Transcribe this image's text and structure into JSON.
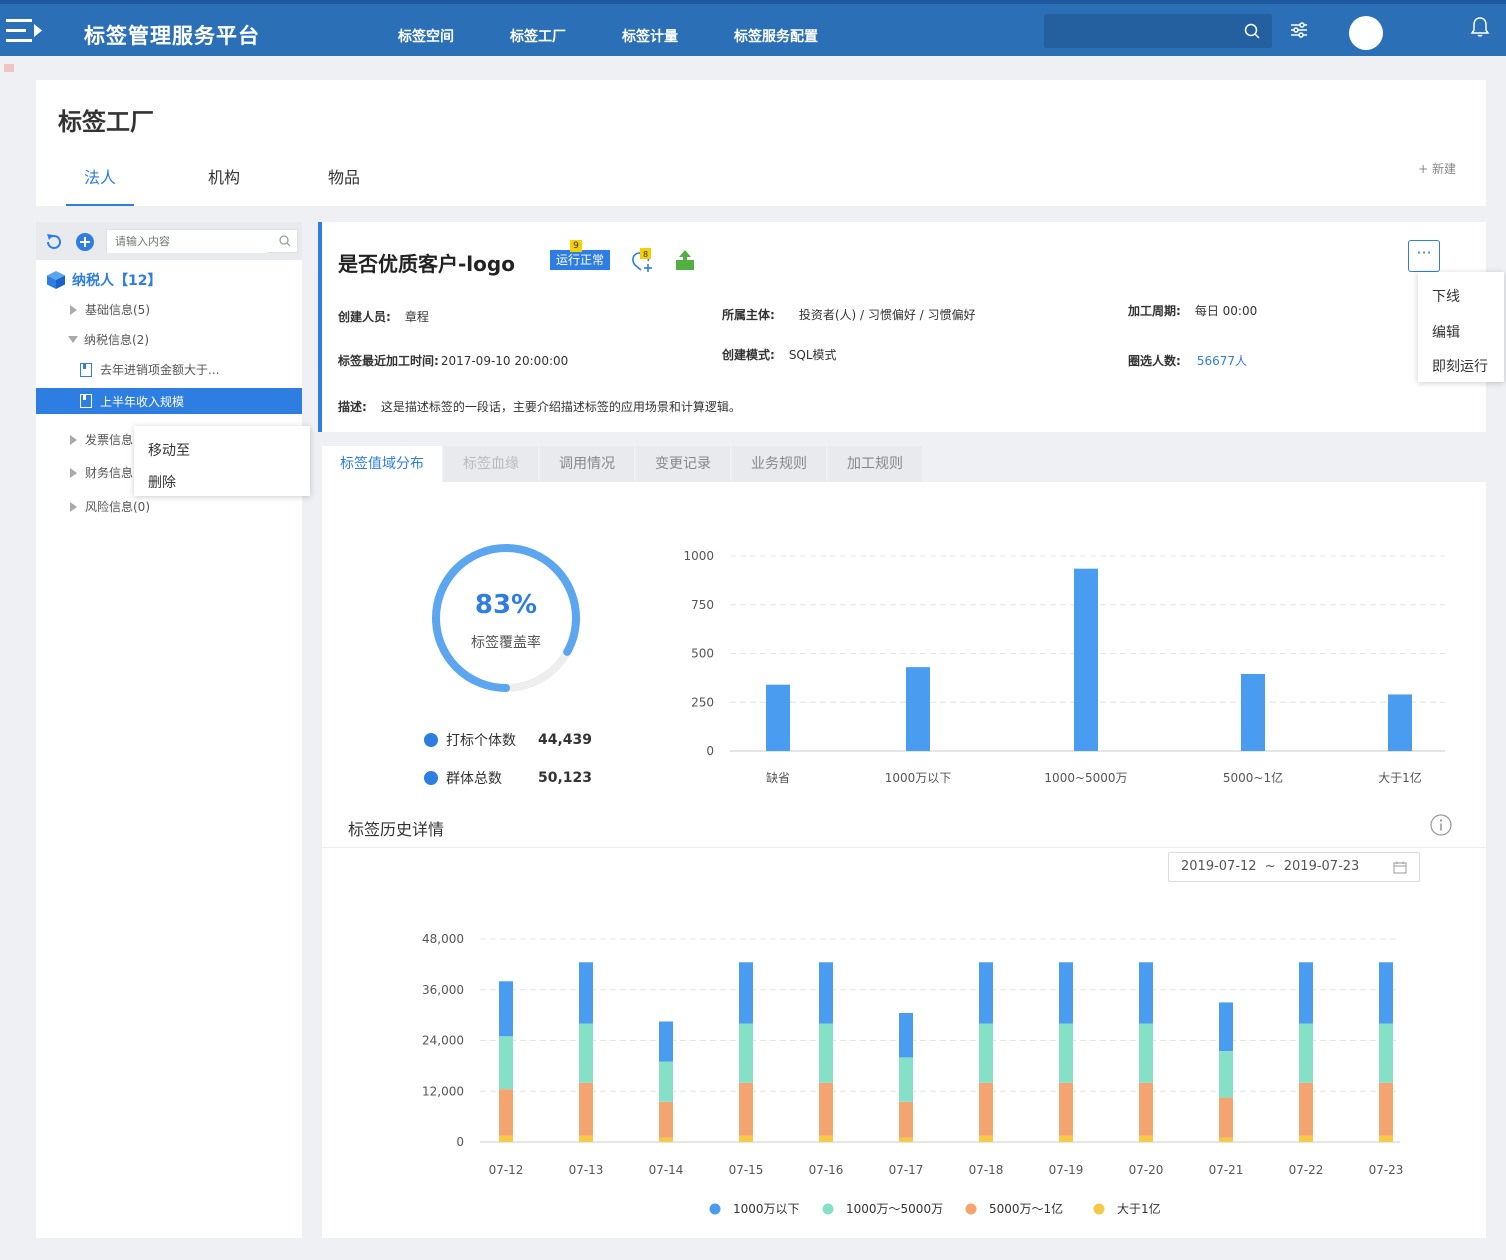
{
  "topbar": {
    "brand": "标签管理服务平台",
    "nav": [
      "标签空间",
      "标签工厂",
      "标签计量",
      "标签服务配置"
    ]
  },
  "header": {
    "title": "标签工厂",
    "tabs": [
      "法人",
      "机构",
      "物品"
    ],
    "new_label": "+ 新建"
  },
  "sidebar": {
    "search_placeholder": "请输入内容",
    "root": "纳税人【12】",
    "items": [
      {
        "label": "基础信息(5)"
      },
      {
        "label": "纳税信息(2)"
      },
      {
        "label": "去年进销项金额大于..."
      },
      {
        "label": "上半年收入规模"
      },
      {
        "label": "发票信息"
      },
      {
        "label": "财务信息"
      },
      {
        "label": "风险信息(0)"
      }
    ],
    "context_menu": [
      "移动至",
      "删除"
    ]
  },
  "detail": {
    "title": "是否优质客户-logo",
    "status": "运行正常",
    "status_count": "9",
    "follow_count": "8",
    "creator_label": "创建人员:",
    "creator": "章程",
    "subject_label": "所属主体:",
    "subject": "投资者(人) / 习惯偏好 / 习惯偏好",
    "cycle_label": "加工周期:",
    "cycle": "每日 00:00",
    "last_time_label": "标签最近加工时间:",
    "last_time": "2017-09-10 20:00:00",
    "mode_label": "创建模式:",
    "mode": "SQL模式",
    "count_label": "圈选人数:",
    "count": "56677人",
    "desc_label": "描述:",
    "desc": "这是描述标签的一段话，主要介绍描述标签的应用场景和计算逻辑。",
    "more_label": "···",
    "actions": [
      "下线",
      "编辑",
      "即刻运行"
    ]
  },
  "content_tabs": [
    "标签值域分布",
    "标签血缘",
    "调用情况",
    "变更记录",
    "业务规则",
    "加工规则"
  ],
  "coverage": {
    "percent": "83%",
    "fraction": 0.83,
    "label": "标签覆盖率",
    "stats": [
      {
        "name": "打标个体数",
        "value": "44,439"
      },
      {
        "name": "群体总数",
        "value": "50,123"
      }
    ]
  },
  "history": {
    "title": "标签历史详情",
    "date_start": "2019-07-12",
    "date_sep": "~",
    "date_end": "2019-07-23"
  },
  "colors": {
    "primary": "#2e7de1",
    "bar_blue": "#4a9cf0",
    "teal": "#86e0c8",
    "orange": "#f4a46e",
    "yellow": "#f7c948"
  },
  "chart_data": [
    {
      "type": "bar",
      "categories": [
        "缺省",
        "1000万以下",
        "1000~5000万",
        "5000~1亿",
        "大于1亿"
      ],
      "values": [
        340,
        430,
        935,
        395,
        290
      ],
      "ylim": [
        0,
        1000
      ],
      "yticks": [
        "0",
        "250",
        "500",
        "750",
        "1000"
      ],
      "grid": true
    },
    {
      "type": "bar",
      "stacked": true,
      "categories": [
        "07-12",
        "07-13",
        "07-14",
        "07-15",
        "07-16",
        "07-17",
        "07-18",
        "07-19",
        "07-20",
        "07-21",
        "07-22",
        "07-23"
      ],
      "series": [
        {
          "name": "大于1亿",
          "values": [
            1500,
            1500,
            1000,
            1500,
            1500,
            1000,
            1500,
            1500,
            1500,
            1000,
            1500,
            1500
          ]
        },
        {
          "name": "5000万~1亿",
          "values": [
            11000,
            12500,
            8500,
            12500,
            12500,
            8500,
            12500,
            12500,
            12500,
            9500,
            12500,
            12500
          ]
        },
        {
          "name": "1000万~5000万",
          "values": [
            12500,
            14000,
            9500,
            14000,
            14000,
            10500,
            14000,
            14000,
            14000,
            11000,
            14000,
            14000
          ]
        },
        {
          "name": "1000万以下",
          "values": [
            13000,
            14500,
            9500,
            14500,
            14500,
            10500,
            14500,
            14500,
            14500,
            11500,
            14500,
            14500
          ]
        }
      ],
      "legend": [
        "1000万以下",
        "1000万～5000万",
        "5000万～1亿",
        "大于1亿"
      ],
      "ylim": [
        0,
        48000
      ],
      "yticks": [
        "0",
        "12,000",
        "24,000",
        "36,000",
        "48,000"
      ],
      "grid": true,
      "legend_position": "bottom"
    }
  ]
}
